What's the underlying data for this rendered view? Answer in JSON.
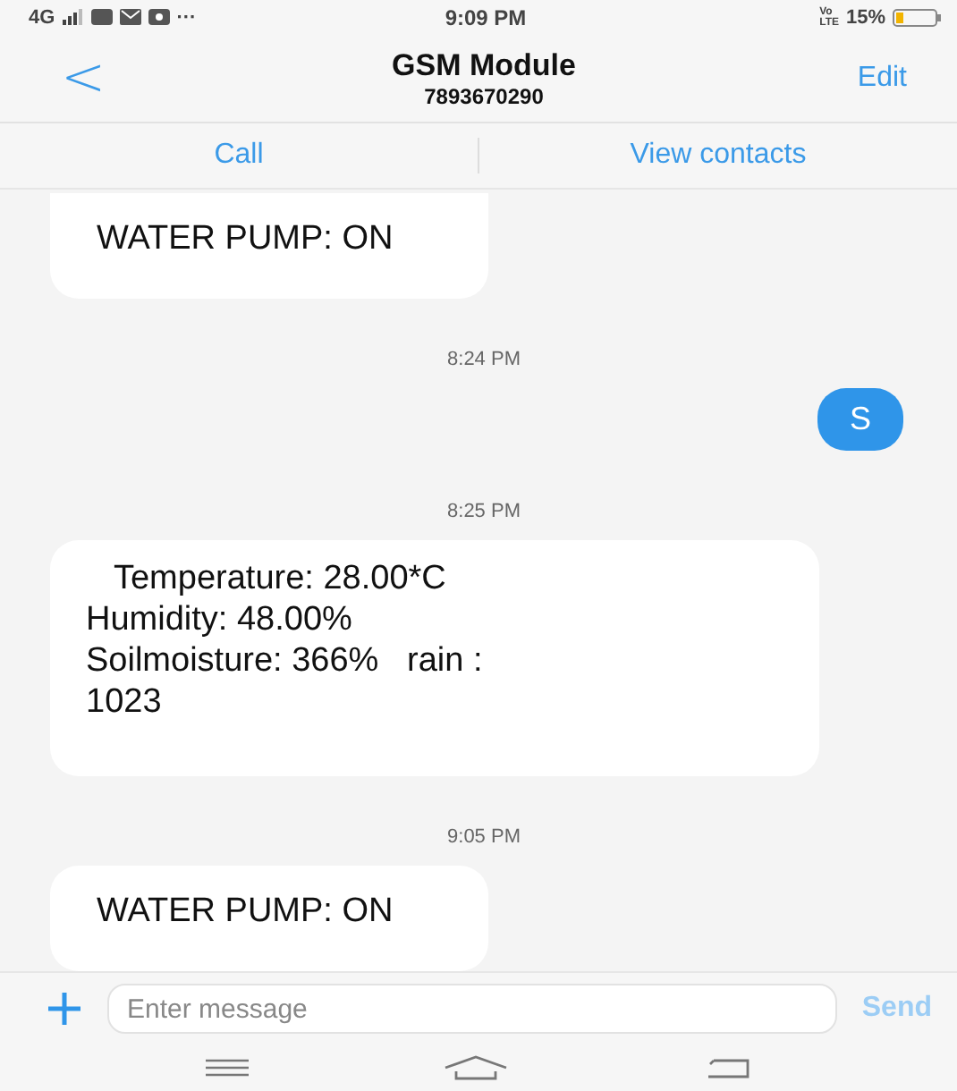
{
  "status_bar": {
    "network": "4G",
    "more": "···",
    "time": "9:09 PM",
    "volte": "Vo\nLTE",
    "battery": "15%"
  },
  "header": {
    "back": "<",
    "title": "GSM Module",
    "subtitle": "7893670290",
    "edit": "Edit"
  },
  "actions": [
    "Call",
    "View contacts"
  ],
  "messages": [
    {
      "kind": "received",
      "text": "WATER PUMP: ON"
    },
    {
      "kind": "time",
      "text": "8:24 PM"
    },
    {
      "kind": "sent",
      "text": "S"
    },
    {
      "kind": "time",
      "text": "8:25 PM"
    },
    {
      "kind": "received",
      "text": "   Temperature: 28.00*C\nHumidity: 48.00%\nSoilmoisture: 366%   rain :\n1023"
    },
    {
      "kind": "time",
      "text": "9:05 PM"
    },
    {
      "kind": "received",
      "text": "WATER PUMP: ON"
    }
  ],
  "composer": {
    "placeholder": "Enter message",
    "send": "Send",
    "send_disabled": true
  }
}
